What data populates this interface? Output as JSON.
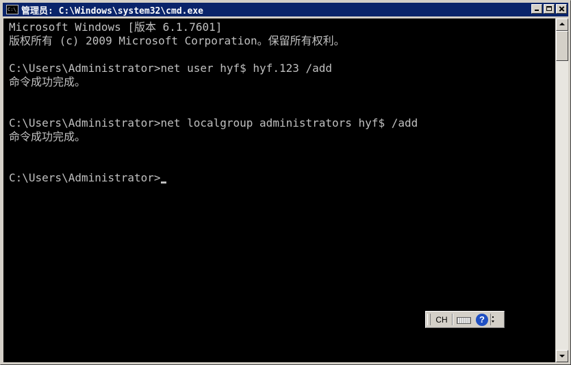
{
  "window": {
    "title": "管理员: C:\\Windows\\system32\\cmd.exe",
    "icon_label": "C:\\_",
    "icon": "cmd-icon",
    "title_bar_color": "#0a246a"
  },
  "controls": {
    "minimize": "minimize-icon",
    "maximize": "maximize-icon",
    "close": "close-icon"
  },
  "console": {
    "background": "#000000",
    "foreground": "#c0c0c0",
    "lines": [
      "Microsoft Windows [版本 6.1.7601]",
      "版权所有 (c) 2009 Microsoft Corporation。保留所有权利。",
      "",
      "C:\\Users\\Administrator>net user hyf$ hyf.123 /add",
      "命令成功完成。",
      "",
      "",
      "C:\\Users\\Administrator>net localgroup administrators hyf$ /add",
      "命令成功完成。",
      "",
      "",
      "C:\\Users\\Administrator>"
    ]
  },
  "language_bar": {
    "lang": "CH",
    "keyboard_icon": "keyboard-icon",
    "help_icon": "help-icon",
    "help_glyph": "?",
    "menu_icon": "options-menu-icon"
  }
}
